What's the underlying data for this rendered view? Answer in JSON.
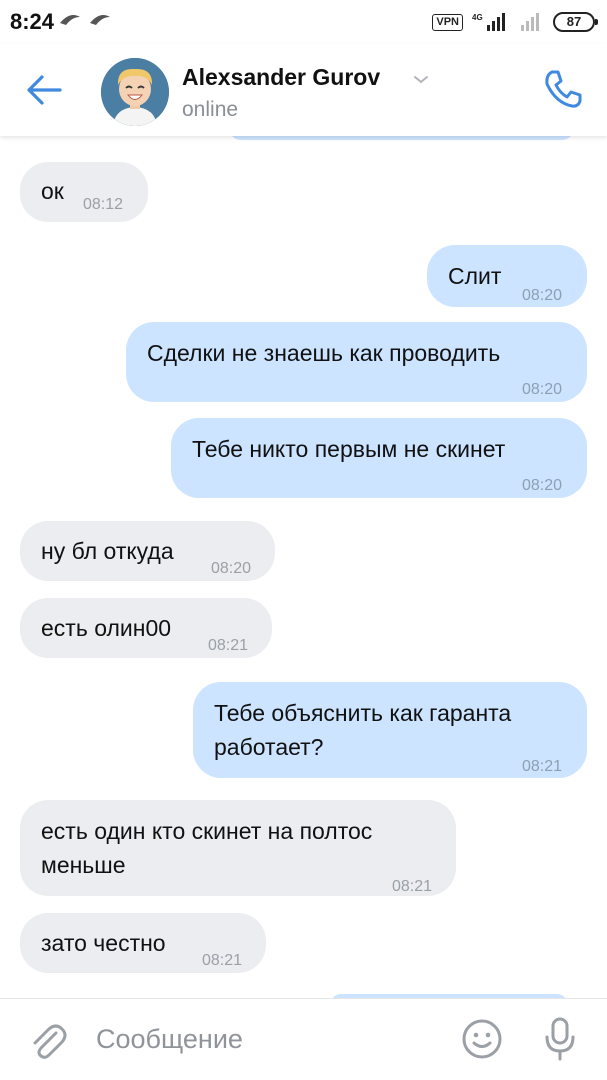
{
  "status_bar": {
    "time": "8:24",
    "vpn_label": "VPN",
    "network_label": "4G",
    "battery": "87",
    "icons": [
      "notification-icon",
      "notification-icon",
      "signal-icon",
      "signal-icon",
      "battery-icon"
    ]
  },
  "header": {
    "contact_name": "Alexsander Gurov",
    "status": "online",
    "icons": [
      "back-arrow-icon",
      "avatar",
      "chevron-down-icon",
      "phone-icon"
    ],
    "accent_color": "#3f8ae0"
  },
  "messages": [
    {
      "direction": "in",
      "text": "ок",
      "time": "08:12"
    },
    {
      "direction": "out",
      "text": "Слит",
      "time": "08:20"
    },
    {
      "direction": "out",
      "text": "Сделки не знаешь как проводить",
      "time": "08:20"
    },
    {
      "direction": "out",
      "text": "Тебе никто первым не скинет",
      "time": "08:20"
    },
    {
      "direction": "in",
      "text": "ну бл откуда",
      "time": "08:20"
    },
    {
      "direction": "in",
      "text": "есть олин00",
      "time": "08:21"
    },
    {
      "direction": "out",
      "text": "Тебе объяснить как гаранта\nработает?",
      "time": "08:21"
    },
    {
      "direction": "in",
      "text": "есть один кто скинет на полтос\nменьше",
      "time": "08:21"
    },
    {
      "direction": "in",
      "text": "зато честно",
      "time": "08:21"
    }
  ],
  "colors": {
    "incoming_bubble": "#ebedf0",
    "outgoing_bubble": "#cce4ff",
    "icon_gray": "#9aa0a6"
  },
  "composer": {
    "placeholder": "Сообщение",
    "icons": [
      "attach-icon",
      "emoji-icon",
      "microphone-icon"
    ]
  }
}
